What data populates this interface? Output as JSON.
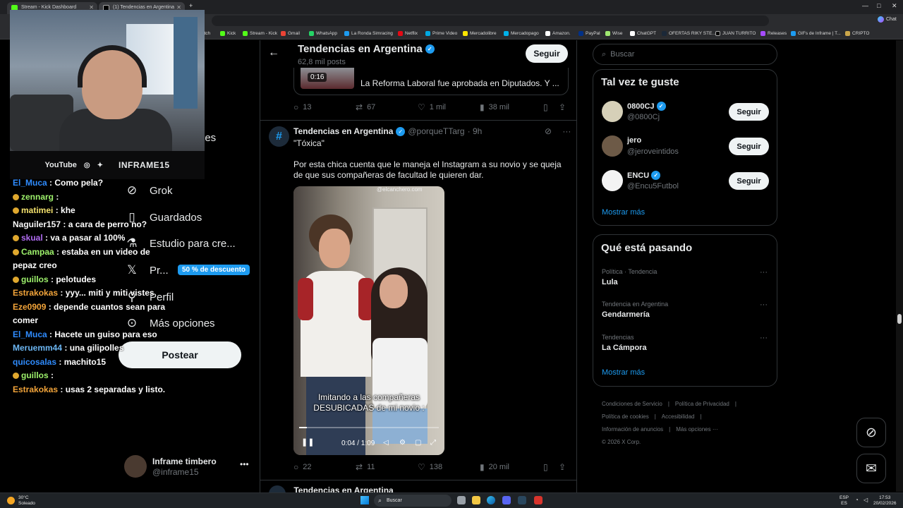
{
  "browser": {
    "tabs": [
      {
        "title": "Stream - Kick Dashboard",
        "color": "#53fc18"
      },
      {
        "title": "(1) Tendencias en Argentina",
        "color": "#000000"
      }
    ],
    "bookmarks": [
      "itch",
      "Kick",
      "Stream - Kick",
      "Gmail",
      "WhatsApp",
      "La Ronda Simracing",
      "Netflix",
      "Prime Video",
      "Mercadolibre",
      "Mercadopago",
      "Amazon.",
      "PayPal",
      "Wise",
      "ChatGPT",
      "OFERTAS RIKY STE...",
      "JUAN TURRITO",
      "Releases",
      "GIFs de Inframe | T...",
      "CRIPTO"
    ],
    "chat_btn": "Chat"
  },
  "overlay": {
    "social": {
      "youtube": "YouTube",
      "brand": "INFRAME15"
    }
  },
  "chat": [
    {
      "user": "El_Muca",
      "color": "#2f8cff",
      "msg": "Como pela?"
    },
    {
      "user": "zennarg",
      "color": "#9ef26c",
      "msg": "",
      "badge": true
    },
    {
      "user": "matimei",
      "color": "#f2e06c",
      "msg": "khe",
      "badge": true
    },
    {
      "user": "Naguiler157",
      "color": "#f7f7f7",
      "msg": "a cara de perro no?"
    },
    {
      "user": "skual",
      "color": "#b06cf2",
      "msg": "va a pasar al 100%",
      "badge": true
    },
    {
      "user": "Campaa",
      "color": "#9ef26c",
      "msg": "estaba en un video de",
      "badge": true
    },
    {
      "user": "",
      "color": "#ffffff",
      "msg": "pepaz creo"
    },
    {
      "user": "guillos",
      "color": "#9ef26c",
      "msg": "pelotudes",
      "badge": true
    },
    {
      "user": "Estrakokas",
      "color": "#f2a43a",
      "msg": "yyy... miti y miti vistes"
    },
    {
      "user": "Eze0909",
      "color": "#f2a43a",
      "msg": "depende cuantos sean para"
    },
    {
      "user": "",
      "color": "#ffffff",
      "msg": "comer"
    },
    {
      "user": "El_Muca",
      "color": "#2f8cff",
      "msg": "Hacete un guiso para eso"
    },
    {
      "user": "Meruemm44",
      "color": "#6cb6f2",
      "msg": "una gilipolles"
    },
    {
      "user": "quicosalas",
      "color": "#2f8cff",
      "msg": "machito15"
    },
    {
      "user": "guillos",
      "color": "#9ef26c",
      "msg": "",
      "badge": true
    },
    {
      "user": "Estrakokas",
      "color": "#f2a43a",
      "msg": "usas 2 separadas y listo."
    }
  ],
  "nav": {
    "opciones_partial": "nes",
    "grok": "Grok",
    "guardados": "Guardados",
    "estudio": "Estudio para cre...",
    "premium": "Pr...",
    "premium_badge": "50 % de descuento",
    "perfil": "Perfil",
    "mas": "Más opciones",
    "post": "Postear",
    "profile_name": "Inframe timbero",
    "profile_handle": "@inframe15"
  },
  "header": {
    "title": "Tendencias en Argentina",
    "posts": "62,8 mil posts",
    "follow": "Seguir"
  },
  "quoted": {
    "duration": "0:16",
    "text": "La Reforma Laboral fue aprobada en Diputados. Y ..."
  },
  "tweet1_actions": {
    "replies": "13",
    "reposts": "67",
    "likes": "1 mil",
    "views": "38 mil"
  },
  "tweet2": {
    "name": "Tendencias en Argentina",
    "handle": "@porqueTTarg",
    "time": "· 9h",
    "line1": "\"Tóxica\"",
    "body": "Por esta chica cuenta que le maneja el Instagram a su novio y se queja de que sus compañeras de facultad le quieren dar.",
    "video": {
      "caption": "Imitando a las compañeras DESUBICADAS de mi novio :",
      "time": "0:04 / 1:09",
      "progress": 0.058,
      "watermark": "@elcanchero.com"
    },
    "actions": {
      "replies": "22",
      "reposts": "11",
      "likes": "138",
      "views": "20 mil"
    }
  },
  "next_tweet_name": "Tendencias en Argentina",
  "sidebar": {
    "search_placeholder": "Buscar",
    "who_title": "Tal vez te guste",
    "who": [
      {
        "name": "0800CJ",
        "handle": "@0800Cj",
        "verified": true,
        "follow": "Seguir"
      },
      {
        "name": "jero",
        "handle": "@jeroveintidos",
        "verified": false,
        "follow": "Seguir"
      },
      {
        "name": "ENCU",
        "handle": "@Encu5Futbol",
        "verified": true,
        "follow": "Seguir"
      }
    ],
    "show_more": "Mostrar más",
    "trends_title": "Qué está pasando",
    "trends": [
      {
        "context": "Política · Tendencia",
        "title": "Lula"
      },
      {
        "context": "Tendencia en Argentina",
        "title": "Gendarmería"
      },
      {
        "context": "Tendencias",
        "title": "La Cámpora"
      }
    ],
    "footer": [
      "Condiciones de Servicio",
      "|",
      "Política de Privacidad",
      "|",
      "Política de cookies",
      "|",
      "Accesibilidad",
      "|",
      "Información de anuncios",
      "|",
      "Más opciones ···",
      "© 2026 X Corp."
    ]
  },
  "taskbar": {
    "weather_temp": "30°C",
    "weather_desc": "Soleado",
    "search": "Buscar",
    "lang1": "ESP",
    "lang2": "ES",
    "time": "17:53",
    "date": "20/02/2026"
  }
}
